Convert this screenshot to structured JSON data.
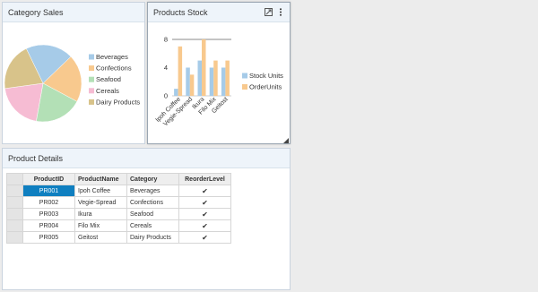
{
  "category_panel": {
    "title": "Category Sales"
  },
  "stock_panel": {
    "title": "Products Stock"
  },
  "details_panel": {
    "title": "Product Details"
  },
  "chart_data": [
    {
      "type": "pie",
      "categories": [
        "Beverages",
        "Confections",
        "Seafood",
        "Cereals",
        "Dairy Products"
      ],
      "values": [
        20,
        20,
        20,
        20,
        20
      ],
      "colors": [
        "#a6cbe8",
        "#f8c98e",
        "#b3e0b6",
        "#f6bcd3",
        "#d8c38a"
      ],
      "legend": "right"
    },
    {
      "type": "bar",
      "categories": [
        "Ipoh Coffee",
        "Vegie-Spread",
        "Ikura",
        "Filo Mix",
        "Geitost"
      ],
      "series": [
        {
          "name": "Stock Units",
          "values": [
            1,
            4,
            5,
            4,
            4
          ],
          "color": "#a6cbe8"
        },
        {
          "name": "OrderUnits",
          "values": [
            7,
            3,
            8,
            5,
            5
          ],
          "color": "#f8c98e"
        }
      ],
      "yticks": [
        "0",
        "4",
        "8"
      ],
      "ylim": [
        0,
        8.5
      ],
      "reference_line": 8,
      "legend": "right"
    }
  ],
  "grid": {
    "columns": [
      "ProductID",
      "ProductName",
      "Category",
      "ReorderLevel"
    ],
    "rows": [
      {
        "id": "PR001",
        "name": "Ipoh Coffee",
        "category": "Beverages",
        "reorder": true
      },
      {
        "id": "PR002",
        "name": "Vegie-Spread",
        "category": "Confections",
        "reorder": true
      },
      {
        "id": "PR003",
        "name": "Ikura",
        "category": "Seafood",
        "reorder": true
      },
      {
        "id": "PR004",
        "name": "Filo Mix",
        "category": "Cereals",
        "reorder": true
      },
      {
        "id": "PR005",
        "name": "Geitost",
        "category": "Dairy Products",
        "reorder": true
      }
    ],
    "selected_row": 0
  },
  "icons": {
    "maximize": "maximize-icon",
    "more": "more-vertical-icon",
    "resize": "resize-grip-icon",
    "checkbox": "checkbox-checked-icon"
  }
}
